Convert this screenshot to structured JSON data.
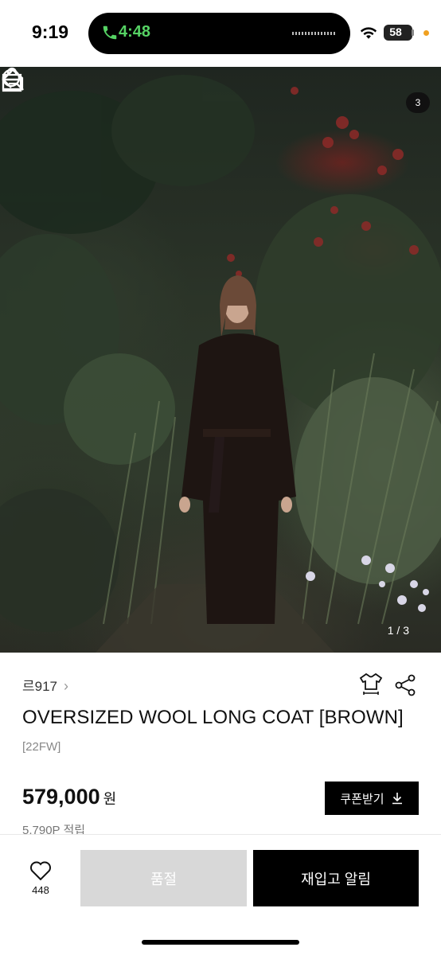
{
  "status_bar": {
    "time": "9:19",
    "call_timer": "4:48",
    "battery": "58"
  },
  "hero": {
    "page_indicator": "1 / 3",
    "cart_count": "3"
  },
  "product": {
    "brand": "르917",
    "title": "OVERSIZED WOOL LONG COAT [BROWN]",
    "season": "[22FW]",
    "price": "579,000",
    "price_unit": "원",
    "coupon_label": "쿠폰받기",
    "points": "5,790P 적립"
  },
  "bottom_bar": {
    "like_count": "448",
    "soldout_label": "품절",
    "restock_label": "재입고 알림"
  },
  "colors": {
    "accent": "#000000",
    "soldout_bg": "#d8d8d8",
    "call_green": "#56d364"
  }
}
